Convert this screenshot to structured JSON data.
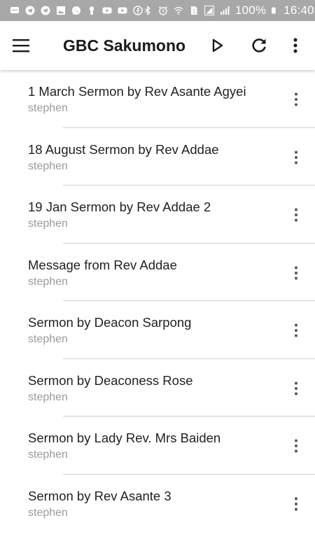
{
  "status_bar": {
    "battery_percent": "100%",
    "time": "16:40",
    "icons": [
      "chat-icon",
      "telegram-icon",
      "telegram-icon",
      "image-icon",
      "whatsapp-icon",
      "keyhole-icon",
      "youtube-icon",
      "youtube-icon",
      "facebook-icon",
      "bluetooth-icon",
      "alarm-icon",
      "wifi-icon",
      "sim-icon",
      "signal-icon",
      "signal-icon",
      "battery-icon"
    ]
  },
  "app_bar": {
    "title": "GBC Sakumono",
    "icons": [
      "menu-icon",
      "play-icon",
      "refresh-icon",
      "more-vert-icon"
    ]
  },
  "sermons": [
    {
      "title": "1 March Sermon by Rev Asante Agyei",
      "author": "stephen"
    },
    {
      "title": "18 August Sermon by Rev Addae",
      "author": "stephen"
    },
    {
      "title": "19 Jan Sermon by Rev Addae 2",
      "author": "stephen"
    },
    {
      "title": "Message from Rev Addae",
      "author": "stephen"
    },
    {
      "title": "Sermon by Deacon Sarpong",
      "author": "stephen"
    },
    {
      "title": "Sermon by Deaconess Rose",
      "author": "stephen"
    },
    {
      "title": "Sermon by Lady Rev. Mrs Baiden",
      "author": "stephen"
    },
    {
      "title": "Sermon by Rev Asante 3",
      "author": "stephen"
    }
  ]
}
